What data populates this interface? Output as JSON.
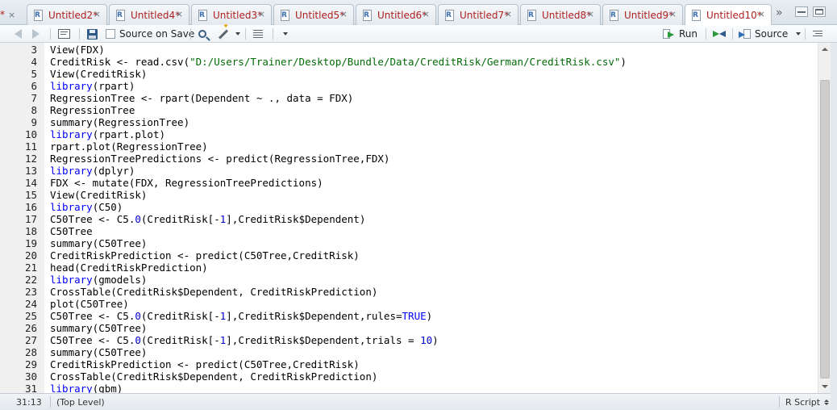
{
  "tabs": {
    "first_fragment": "*",
    "items": [
      {
        "label": "Untitled2*"
      },
      {
        "label": "Untitled4*"
      },
      {
        "label": "Untitled3*"
      },
      {
        "label": "Untitled5*"
      },
      {
        "label": "Untitled6*"
      },
      {
        "label": "Untitled7*"
      },
      {
        "label": "Untitled8*"
      },
      {
        "label": "Untitled9*"
      },
      {
        "label": "Untitled10*",
        "active": true
      }
    ],
    "close_glyph": "×",
    "overflow_glyph": "»"
  },
  "toolbar": {
    "source_on_save_label": "Source on Save",
    "source_on_save_checked": false,
    "run_label": "Run",
    "source_label": "Source",
    "icons": [
      "back-arrow-icon",
      "forward-arrow-icon",
      "show-in-window-icon",
      "save-icon",
      "search-icon",
      "code-tools-wand-icon",
      "compile-report-icon",
      "run-icon",
      "rerun-icon",
      "source-icon",
      "outline-icon"
    ]
  },
  "editor": {
    "lines": [
      {
        "n": "3",
        "code": "View(FDX)"
      },
      {
        "n": "4",
        "code": "CreditRisk <- read.csv(\"D:/Users/Trainer/Desktop/Bundle/Data/CreditRisk/German/CreditRisk.csv\")"
      },
      {
        "n": "5",
        "code": "View(CreditRisk)"
      },
      {
        "n": "6",
        "code": "library(rpart)"
      },
      {
        "n": "7",
        "code": "RegressionTree <- rpart(Dependent ~ ., data = FDX)"
      },
      {
        "n": "8",
        "code": "RegressionTree"
      },
      {
        "n": "9",
        "code": "summary(RegressionTree)"
      },
      {
        "n": "10",
        "code": "library(rpart.plot)"
      },
      {
        "n": "11",
        "code": "rpart.plot(RegressionTree)"
      },
      {
        "n": "12",
        "code": "RegressionTreePredictions <- predict(RegressionTree,FDX)"
      },
      {
        "n": "13",
        "code": "library(dplyr)"
      },
      {
        "n": "14",
        "code": "FDX <- mutate(FDX, RegressionTreePredictions)"
      },
      {
        "n": "15",
        "code": "View(CreditRisk)"
      },
      {
        "n": "16",
        "code": "library(C50)"
      },
      {
        "n": "17",
        "code": "C50Tree <- C5.0(CreditRisk[-1],CreditRisk$Dependent)"
      },
      {
        "n": "18",
        "code": "C50Tree"
      },
      {
        "n": "19",
        "code": "summary(C50Tree)"
      },
      {
        "n": "20",
        "code": "CreditRiskPrediction <- predict(C50Tree,CreditRisk)"
      },
      {
        "n": "21",
        "code": "head(CreditRiskPrediction)"
      },
      {
        "n": "22",
        "code": "library(gmodels)"
      },
      {
        "n": "23",
        "code": "CrossTable(CreditRisk$Dependent, CreditRiskPrediction)"
      },
      {
        "n": "24",
        "code": "plot(C50Tree)"
      },
      {
        "n": "25",
        "code": "C50Tree <- C5.0(CreditRisk[-1],CreditRisk$Dependent,rules=TRUE)"
      },
      {
        "n": "26",
        "code": "summary(C50Tree)"
      },
      {
        "n": "27",
        "code": "C50Tree <- C5.0(CreditRisk[-1],CreditRisk$Dependent,trials = 10)"
      },
      {
        "n": "28",
        "code": "summary(C50Tree)"
      },
      {
        "n": "29",
        "code": "CreditRiskPrediction <- predict(C50Tree,CreditRisk)"
      },
      {
        "n": "30",
        "code": "CrossTable(CreditRisk$Dependent, CreditRiskPrediction)"
      },
      {
        "n": "31",
        "code": "library(gbm)"
      }
    ]
  },
  "statusbar": {
    "cursor_position": "31:13",
    "scope": "(Top Level)",
    "language": "R Script"
  },
  "colors": {
    "tab_label": "#b01f1f",
    "keyword": "#0000ff",
    "string": "#036a07",
    "number": "#0000cd",
    "run_green": "#2b9a3b"
  }
}
